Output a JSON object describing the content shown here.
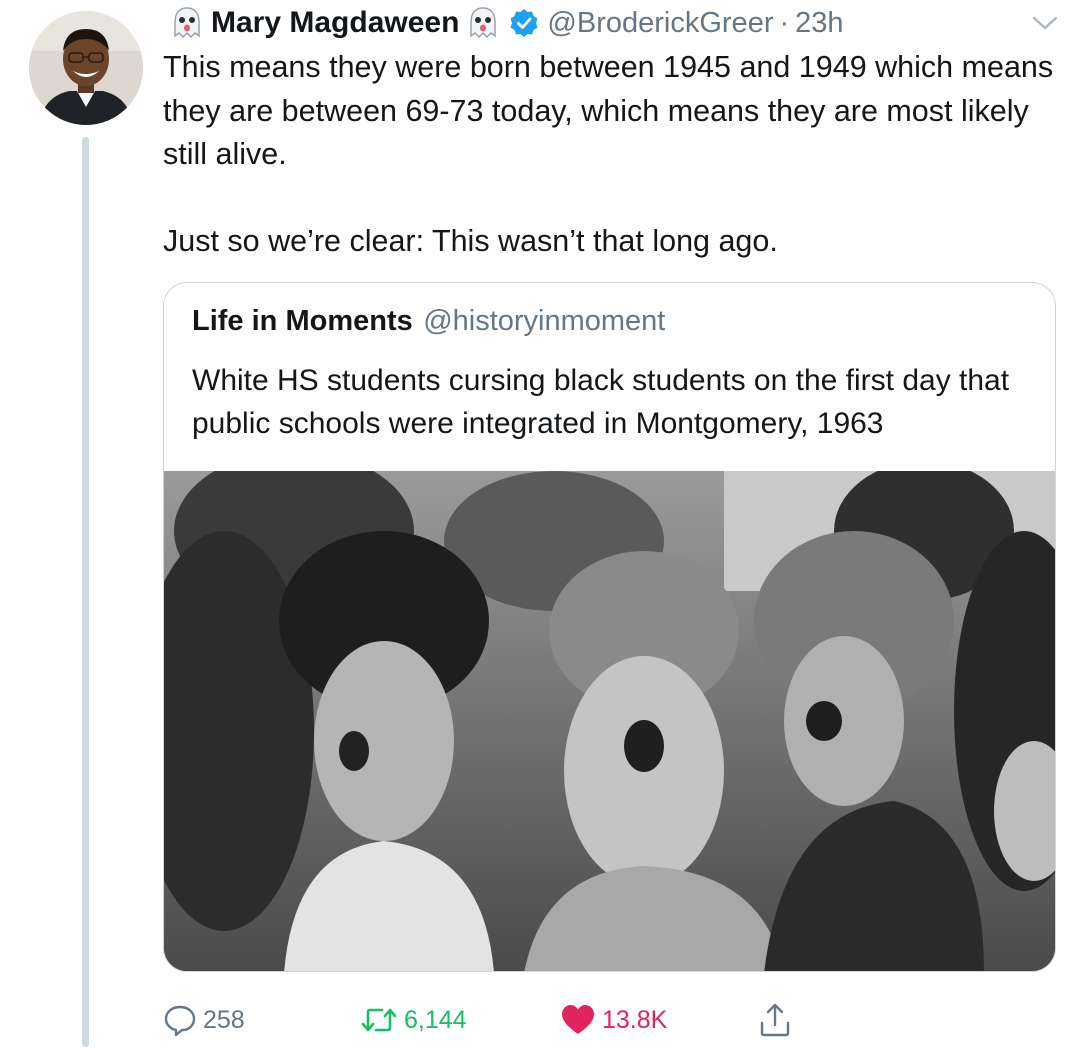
{
  "author": {
    "display_name": "Mary Magdaween",
    "handle": "@BroderickGreer",
    "separator": "·",
    "timestamp": "23h",
    "verified": true
  },
  "tweet": {
    "paragraph_1": "This means they were born between 1945 and 1949 which means they are between 69-73 today, which means they are most likely still alive.",
    "paragraph_2": "Just so we’re clear: This wasn’t that long ago."
  },
  "quoted_tweet": {
    "display_name": "Life in Moments",
    "handle": "@historyinmoment",
    "text": "White HS students cursing black students on the first day that public schools were integrated in Montgomery, 1963"
  },
  "actions": {
    "reply_count": "258",
    "retweet_count": "6,144",
    "like_count": "13.8K"
  },
  "colors": {
    "text_primary": "#14171a",
    "text_secondary": "#657786",
    "verified_blue": "#1da1f2",
    "retweet_green": "#17bf63",
    "like_red": "#e0245e",
    "thread_line": "#cfd9de"
  },
  "icons": {
    "reply": "reply-icon",
    "retweet": "retweet-icon",
    "like": "heart-icon",
    "share": "share-icon",
    "more": "chevron-down-icon",
    "verified": "verified-badge-icon",
    "name_emoji": "ghost-emoji-icon"
  }
}
